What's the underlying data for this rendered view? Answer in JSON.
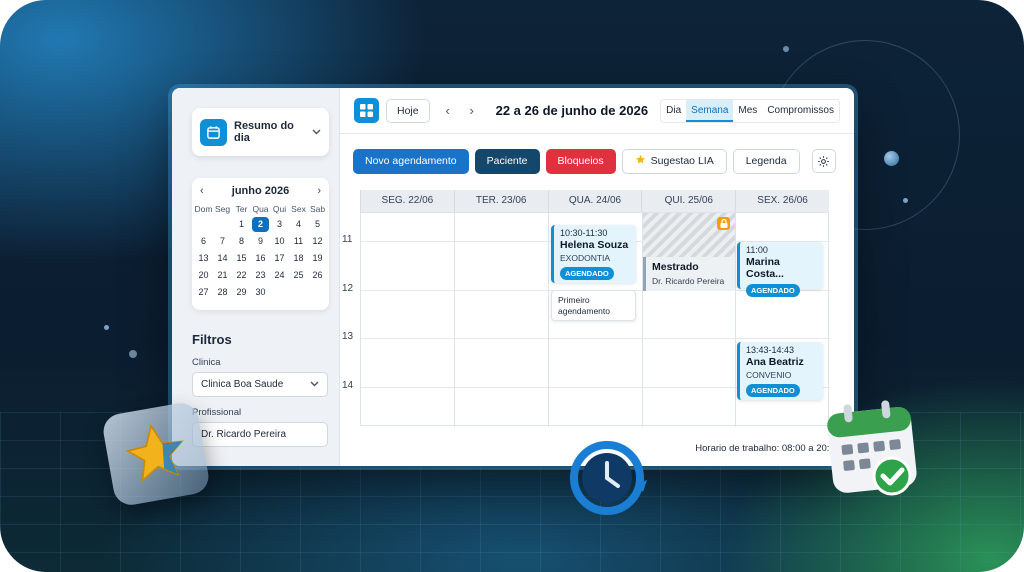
{
  "sidebar": {
    "summary_label": "Resumo do dia",
    "mini_calendar": {
      "month": "junho 2026",
      "prev": "‹",
      "next": "›",
      "weekdays": [
        "Dom",
        "Seg",
        "Ter",
        "Qua",
        "Qui",
        "Sex",
        "Sab"
      ],
      "weeks": [
        [
          "",
          "",
          "1",
          "2",
          "3",
          "4",
          "5"
        ],
        [
          "6",
          "7",
          "8",
          "9",
          "10",
          "11",
          "12"
        ],
        [
          "13",
          "14",
          "15",
          "16",
          "17",
          "18",
          "19"
        ],
        [
          "20",
          "21",
          "22",
          "23",
          "24",
          "25",
          "26"
        ],
        [
          "27",
          "28",
          "29",
          "30",
          "",
          "",
          ""
        ]
      ],
      "selected_day": "2"
    },
    "filters_title": "Filtros",
    "clinic_label": "Clinica",
    "clinic_value": "Clinica Boa Saude",
    "professional_label": "Profissional",
    "professional_value": "Dr. Ricardo Pereira"
  },
  "toolbar": {
    "today_label": "Hoje",
    "prev_arrow": "‹",
    "next_arrow": "›",
    "date_range": "22 a 26 de junho de 2026",
    "views": [
      "Dia",
      "Semana",
      "Mes",
      "Compromissos"
    ],
    "active_view": "Semana"
  },
  "actions": {
    "new_appointment": "Novo agendamento",
    "patient": "Paciente",
    "blocks": "Bloqueios",
    "suggestion": "Sugestao LIA",
    "legend": "Legenda"
  },
  "calendar": {
    "days": [
      "SEG. 22/06",
      "TER. 23/06",
      "QUA. 24/06",
      "QUI. 25/06",
      "SEX. 26/06"
    ],
    "hours": [
      "11",
      "12",
      "13",
      "14"
    ],
    "events": {
      "helena": {
        "time": "10:30-11:30",
        "name": "Helena Souza",
        "type": "EXODONTIA",
        "status": "AGENDADO"
      },
      "first": {
        "text": "Primeiro agendamento"
      },
      "block": {
        "name": "Mestrado",
        "doctor": "Dr. Ricardo Pereira"
      },
      "marina": {
        "time": "11:00",
        "name": "Marina Costa...",
        "status": "AGENDADO"
      },
      "ana": {
        "time": "13:43-14:43",
        "name": "Ana Beatriz",
        "type": "CONVENIO",
        "status": "AGENDADO"
      }
    },
    "work_hours": "Horario de trabalho: 08:00 a 20:00"
  },
  "colors": {
    "primary": "#0f8fd6",
    "new_button": "#1873c9",
    "patient_button": "#14476a",
    "blocks_button": "#e0313f",
    "suggestion_star": "#f5b400"
  }
}
